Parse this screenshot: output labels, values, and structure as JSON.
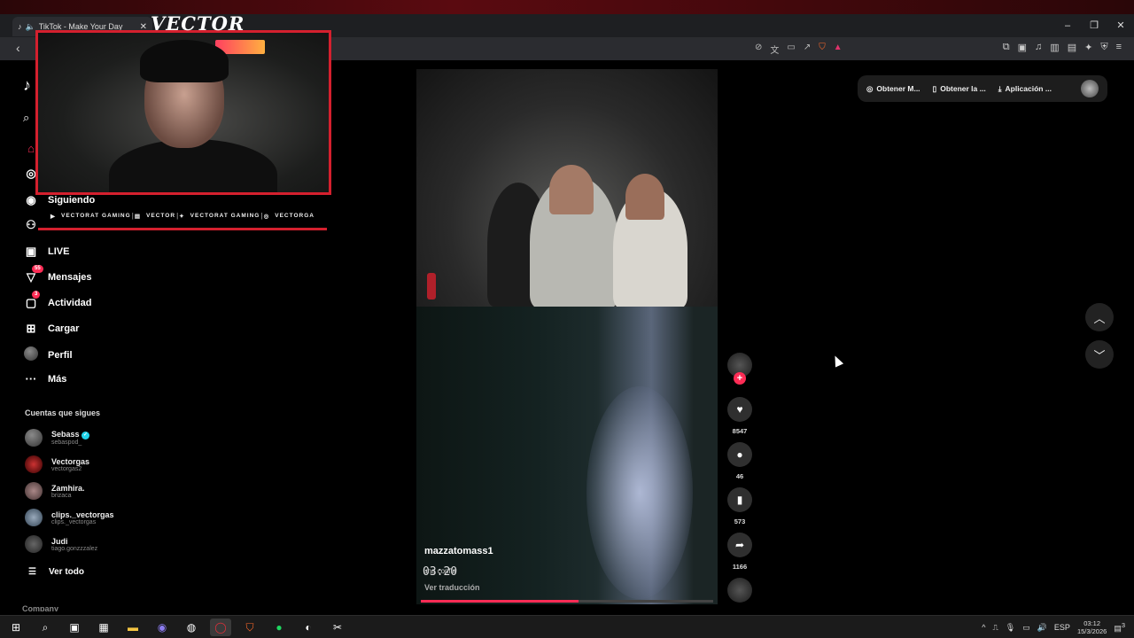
{
  "browser": {
    "tab_title": "TikTok - Make Your Day",
    "tab_favicon": "tiktok-icon",
    "window_controls": [
      "–",
      "❐",
      "✕"
    ]
  },
  "overlay": {
    "streamer_logo": "VECTOR",
    "socials": [
      {
        "icon": "youtube-icon",
        "label": "VECTORAT GAMING"
      },
      {
        "icon": "twitch-icon",
        "label": "VECTOR"
      },
      {
        "icon": "twitter-icon",
        "label": "VECTORAT GAMING"
      },
      {
        "icon": "instagram-icon",
        "label": "VECTORGA"
      }
    ]
  },
  "sidebar": {
    "nav": [
      {
        "label": "Siguiendo",
        "icon": "following-icon"
      },
      {
        "label": "LIVE",
        "icon": "live-icon"
      },
      {
        "label": "Mensajes",
        "icon": "messages-icon",
        "badge": "55"
      },
      {
        "label": "Actividad",
        "icon": "activity-icon",
        "badge": "3"
      },
      {
        "label": "Cargar",
        "icon": "upload-icon"
      },
      {
        "label": "Perfil",
        "icon": "profile-avatar"
      },
      {
        "label": "Más",
        "icon": "more-icon"
      }
    ],
    "following_title": "Cuentas que sigues",
    "accounts": [
      {
        "name": "Sebass",
        "handle": "sebaspod_",
        "verified": true
      },
      {
        "name": "Vectorgas",
        "handle": "vectorgas2"
      },
      {
        "name": "Zamhira.",
        "handle": "brizaca"
      },
      {
        "name": "clips._vectorgas",
        "handle": "clips._vectorgas"
      },
      {
        "name": "Judi",
        "handle": "tiago.gonzzzalez"
      }
    ],
    "see_all": "Ver todo",
    "company": "Company"
  },
  "top_actions": [
    {
      "label": "Obtener M...",
      "icon": "coin-icon"
    },
    {
      "label": "Obtener la ...",
      "icon": "phone-icon"
    },
    {
      "label": "Aplicación ...",
      "icon": "download-icon"
    }
  ],
  "video": {
    "username": "mazzatomass1",
    "timestamp": "03:20",
    "description": "una confia",
    "translate": "Ver traducción",
    "progress": 0.54,
    "likes": "8547",
    "comments": "46",
    "saves": "573",
    "shares": "1166"
  },
  "taskbar": {
    "lang": "ESP",
    "time": "03:12",
    "date": "15/3/2026",
    "notifications": "3"
  },
  "colors": {
    "tiktok_red": "#fe2c55",
    "overlay_red": "#d4202e"
  }
}
